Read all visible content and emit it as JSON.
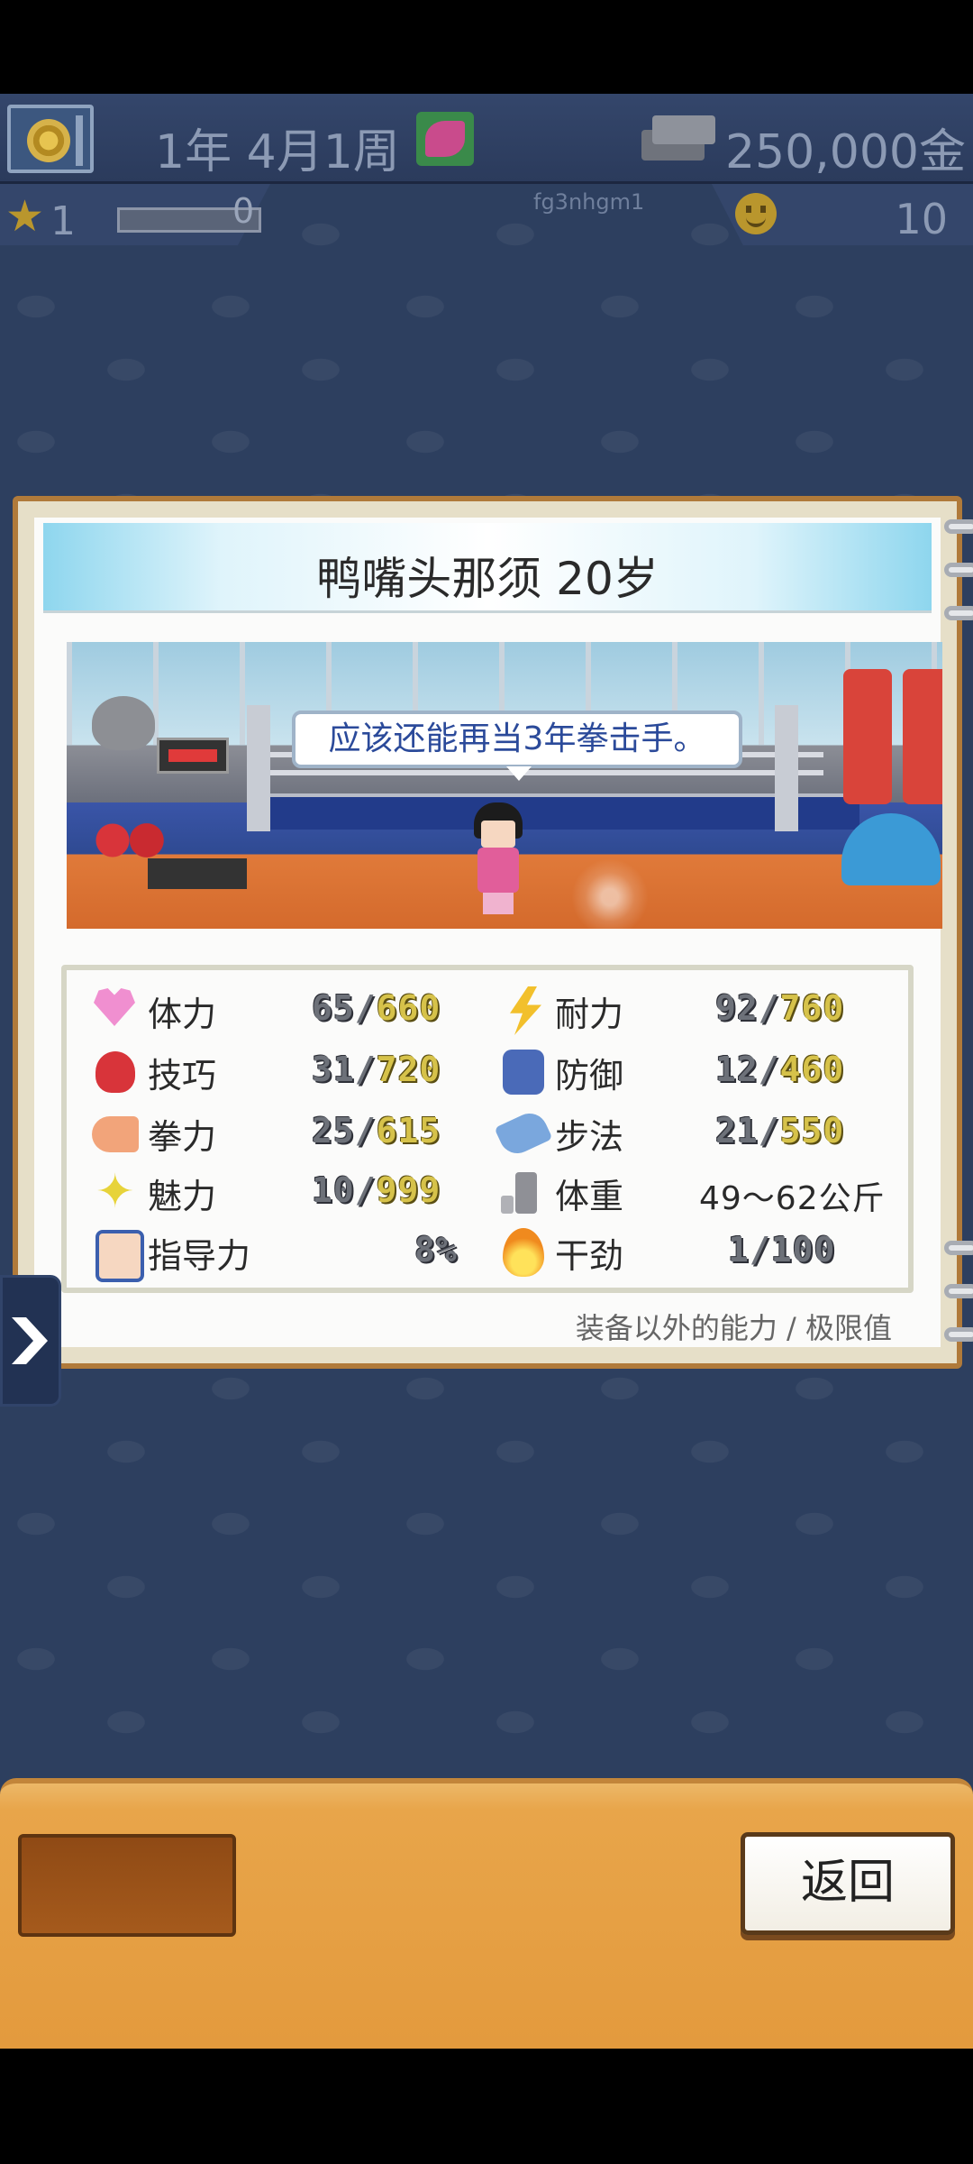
{
  "header": {
    "date": "1年 4月1周",
    "money": "250,000金"
  },
  "subbar": {
    "rank": "1",
    "exp_value": "0",
    "user_id": "fg3nhgm1",
    "fans": "10"
  },
  "card": {
    "title": "鸭嘴头那须 20岁",
    "speech": "应该还能再当3年拳击手。",
    "footnote": "装备以外的能力 / 极限值"
  },
  "stats": {
    "left": [
      {
        "icon": "heart-icon",
        "label": "体力",
        "current": "65",
        "max": "660"
      },
      {
        "icon": "boxing-glove-icon",
        "label": "技巧",
        "current": "31",
        "max": "720"
      },
      {
        "icon": "flexed-arm-icon",
        "label": "拳力",
        "current": "25",
        "max": "615"
      },
      {
        "icon": "sparkle-icon",
        "label": "魅力",
        "current": "10",
        "max": "999"
      },
      {
        "icon": "coach-portrait-icon",
        "label": "指导力",
        "value": "8%"
      }
    ],
    "right": [
      {
        "icon": "lightning-icon",
        "label": "耐力",
        "current": "92",
        "max": "760"
      },
      {
        "icon": "guard-icon",
        "label": "防御",
        "current": "12",
        "max": "460"
      },
      {
        "icon": "shoe-icon",
        "label": "步法",
        "current": "21",
        "max": "550"
      },
      {
        "icon": "weight-icon",
        "label": "体重",
        "value": "49～62公斤"
      },
      {
        "icon": "fire-icon",
        "label": "干劲",
        "current": "1",
        "max": "100"
      }
    ]
  },
  "bottom": {
    "back_label": "返回"
  },
  "colors": {
    "background": "#2d3f5f",
    "card_border": "#b07a3a",
    "bottom_panel": "#e39a3d",
    "max_value": "#d6c24a"
  }
}
